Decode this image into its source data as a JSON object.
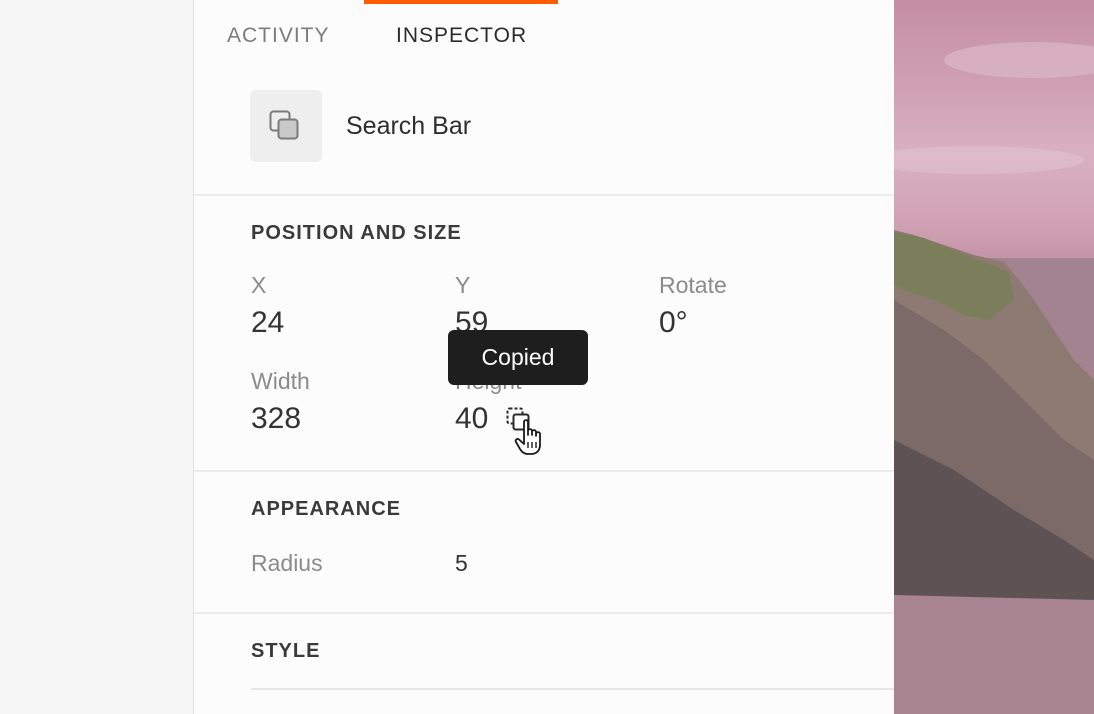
{
  "tabs": {
    "activity": "ACTIVITY",
    "inspector": "INSPECTOR",
    "active": "inspector"
  },
  "element": {
    "name": "Search Bar",
    "icon": "layers-icon"
  },
  "position_size": {
    "title": "POSITION AND SIZE",
    "x_label": "X",
    "x_value": "24",
    "y_label": "Y",
    "y_value": "59",
    "rotate_label": "Rotate",
    "rotate_value": "0°",
    "width_label": "Width",
    "width_value": "328",
    "height_label": "Height",
    "height_value": "40"
  },
  "tooltip": {
    "text": "Copied"
  },
  "appearance": {
    "title": "APPEARANCE",
    "radius_label": "Radius",
    "radius_value": "5"
  },
  "style": {
    "title": "STYLE"
  },
  "colors": {
    "accent": "#ff5c00",
    "tooltip_bg": "#1e1e1e",
    "panel_bg": "#fcfcfc"
  }
}
